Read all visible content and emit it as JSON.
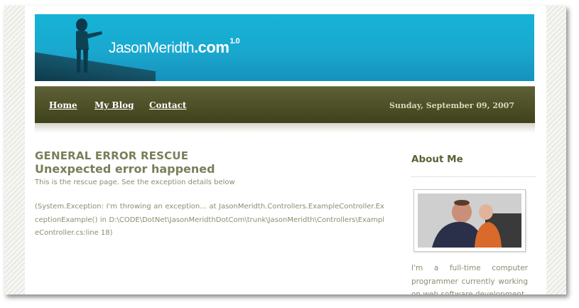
{
  "header": {
    "site_name": "JasonMeridth",
    "site_tld": ".com",
    "version": "1.0"
  },
  "nav": {
    "items": [
      {
        "label": "Home"
      },
      {
        "label": "My Blog"
      },
      {
        "label": "Contact"
      }
    ],
    "date": "Sunday, September 09, 2007"
  },
  "main": {
    "title": "GENERAL ERROR RESCUE",
    "subtitle": "Unexpected error happened",
    "description": "This is the rescue page. See the exception details below",
    "exception": "(System.Exception: I'm throwing an exception... at JasonMeridth.Controllers.ExampleController.ExceptionExample() in D:\\CODE\\DotNet\\JasonMeridthDotCom\\trunk\\JasonMeridth\\Controllers\\ExampleController.cs:line 18)"
  },
  "sidebar": {
    "heading": "About Me",
    "bio": "I'm a full-time computer programmer currently working on web software development"
  },
  "colors": {
    "banner": "#16b3d6",
    "navbar": "#4e5027",
    "heading": "#7a7e59",
    "body_text": "#8b8d70"
  }
}
